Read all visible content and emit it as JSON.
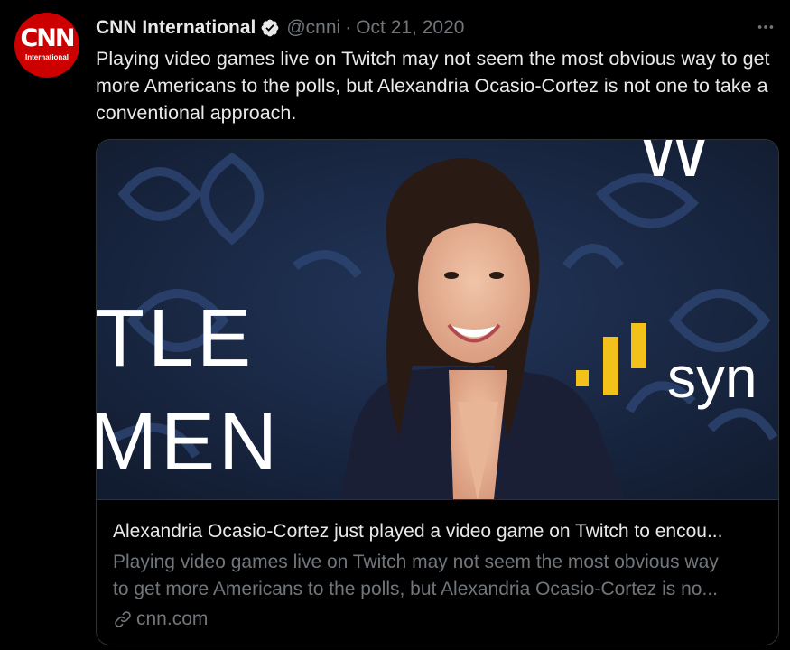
{
  "tweet": {
    "author": {
      "display_name": "CNN International",
      "handle": "@cnni",
      "verified": true,
      "avatar_logo_text": "CNN",
      "avatar_logo_subtext": "International"
    },
    "separator": "·",
    "date": "Oct 21, 2020",
    "text": "Playing video games live on Twitch may not seem the most obvious way to get more Americans to the polls, but Alexandria Ocasio-Cortez is not one to take a conventional approach.",
    "more_icon": "more-horizontal-icon"
  },
  "card": {
    "image_sign_text_left_1": "TLE",
    "image_sign_text_left_2": "MEN",
    "image_sign_text_top": "W",
    "image_sign_text_right": "syn",
    "title": "Alexandria Ocasio-Cortez just played a video game on Twitch to encou...",
    "description_line_1": "Playing video games live on Twitch may not seem the most obvious way",
    "description_line_2": "to get more Americans to the polls, but Alexandria Ocasio-Cortez is no...",
    "domain": "cnn.com",
    "domain_icon": "link-icon"
  },
  "colors": {
    "background": "#000000",
    "primary_text": "#e7e9ea",
    "secondary_text": "#71767b",
    "border": "#2f3336",
    "cnn_red": "#cc0000",
    "verified_badge": "#e7e9ea"
  }
}
